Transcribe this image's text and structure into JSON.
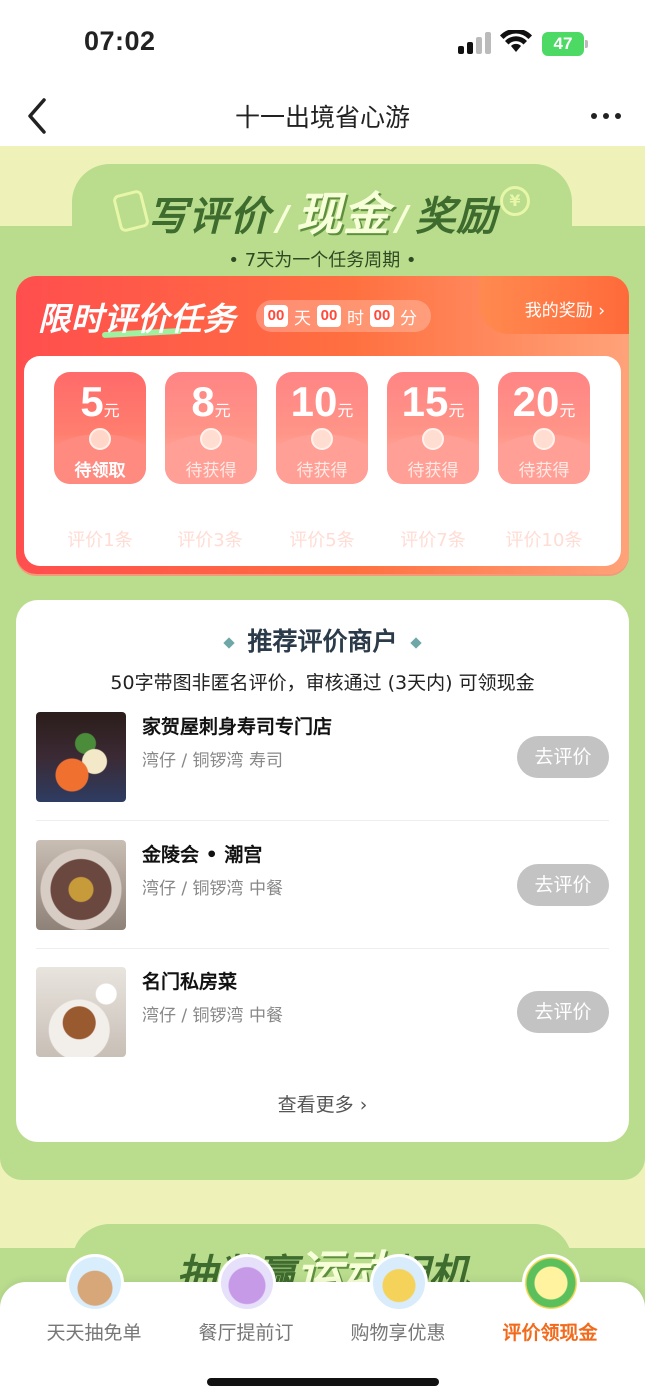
{
  "status_bar": {
    "time": "07:02",
    "battery": "47"
  },
  "nav": {
    "title": "十一出境省心游",
    "back_icon": "chevron-left-icon",
    "more_icon": "more-dots-icon"
  },
  "banner": {
    "title_part1": "写评价",
    "title_part2": "现金",
    "title_part3": "奖励",
    "subtitle": "• 7天为一个任务周期 •"
  },
  "task": {
    "title": "限时评价任务",
    "countdown": {
      "days": "00",
      "day_unit": "天",
      "hours": "00",
      "hour_unit": "时",
      "minutes": "00",
      "minute_unit": "分"
    },
    "my_reward_link": "我的奖励 ›",
    "coupons": [
      {
        "amount": "5",
        "unit": "元",
        "status": "待领取",
        "requirement": "评价1条"
      },
      {
        "amount": "8",
        "unit": "元",
        "status": "待获得",
        "requirement": "评价3条"
      },
      {
        "amount": "10",
        "unit": "元",
        "status": "待获得",
        "requirement": "评价5条"
      },
      {
        "amount": "15",
        "unit": "元",
        "status": "待获得",
        "requirement": "评价7条"
      },
      {
        "amount": "20",
        "unit": "元",
        "status": "待获得",
        "requirement": "评价10条"
      }
    ]
  },
  "recommend": {
    "title": "推荐评价商户",
    "subtitle": "50字带图非匿名评价，审核通过 (3天内) 可领现金",
    "merchants": [
      {
        "name": "家贺屋刺身寿司专门店",
        "location": "湾仔 / 铜锣湾  寿司",
        "button": "去评价"
      },
      {
        "name": "金陵会 • 潮宫",
        "location": "湾仔 / 铜锣湾  中餐",
        "button": "去评价"
      },
      {
        "name": "名门私房菜",
        "location": "湾仔 / 铜锣湾  中餐",
        "button": "去评价"
      }
    ],
    "see_more": "查看更多 ›"
  },
  "banner2": {
    "part1": "抽奖赢",
    "part2": "运动",
    "part3": "相机"
  },
  "tabs": [
    {
      "label": "天天抽免单",
      "icon": "bear-icon",
      "active": false
    },
    {
      "label": "餐厅提前订",
      "icon": "sofa-icon",
      "active": false
    },
    {
      "label": "购物享优惠",
      "icon": "shopping-bag-icon",
      "active": false
    },
    {
      "label": "评价领现金",
      "icon": "review-pen-icon",
      "active": true
    }
  ],
  "colors": {
    "accent": "#f26a1b",
    "panel_green": "#b9dc8d",
    "task_red": "#ff4e4e"
  }
}
